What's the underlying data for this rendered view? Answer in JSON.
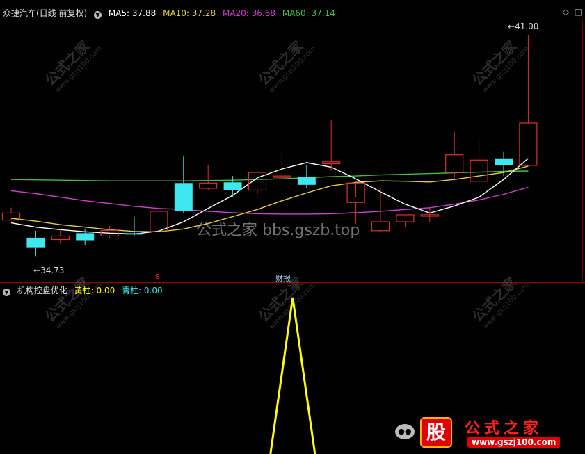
{
  "main_legend": {
    "title": "众捷汽车(日线 前复权)",
    "ma5": "MA5: 37.88",
    "ma10": "MA10: 37.28",
    "ma20": "MA20: 36.68",
    "ma60": "MA60: 37.14",
    "colors": {
      "ma5": "#ffffff",
      "ma10": "#e6d040",
      "ma20": "#d040d0",
      "ma60": "#40c040"
    }
  },
  "sub_legend": {
    "title": "机构控盘优化",
    "yellow": "黄柱: 0.00",
    "cyan": "青柱: 0.00",
    "colors": {
      "yellow": "#ffff00",
      "cyan": "#40e0e0"
    }
  },
  "annotations": {
    "high_label": "41.00",
    "low_label": "34.73",
    "event_label": "财报",
    "s_marker": "S"
  },
  "watermark_center": "公式之家 bbs.gszb.top",
  "watermark_tile": {
    "name": "公式之家",
    "url": "www.gszj100.com"
  },
  "brand": {
    "gu": "股",
    "name": "公式之家",
    "url": "www.gszj100.com"
  },
  "candles": [
    {
      "o": 35.95,
      "h": 36.1,
      "l": 35.8,
      "c": 35.75,
      "up": false
    },
    {
      "o": 35.25,
      "h": 35.45,
      "l": 34.73,
      "c": 34.98,
      "up": true
    },
    {
      "o": 35.2,
      "h": 35.48,
      "l": 35.08,
      "c": 35.3,
      "up": false
    },
    {
      "o": 35.18,
      "h": 35.5,
      "l": 35.05,
      "c": 35.38,
      "up": true
    },
    {
      "o": 35.46,
      "h": 35.58,
      "l": 35.25,
      "c": 35.3,
      "up": false
    },
    {
      "o": 35.38,
      "h": 35.85,
      "l": 35.3,
      "c": 35.35,
      "up": true
    },
    {
      "o": 35.42,
      "h": 36.0,
      "l": 35.36,
      "c": 36.0,
      "up": false
    },
    {
      "o": 36.0,
      "h": 37.55,
      "l": 35.95,
      "c": 36.8,
      "up": true
    },
    {
      "o": 36.8,
      "h": 37.3,
      "l": 36.6,
      "c": 36.65,
      "up": false
    },
    {
      "o": 36.82,
      "h": 37.0,
      "l": 36.4,
      "c": 36.6,
      "up": true
    },
    {
      "o": 36.6,
      "h": 37.1,
      "l": 36.5,
      "c": 37.1,
      "up": false
    },
    {
      "o": 37.0,
      "h": 37.7,
      "l": 36.8,
      "c": 37.0,
      "up": false
    },
    {
      "o": 36.75,
      "h": 37.3,
      "l": 36.65,
      "c": 36.98,
      "up": true
    },
    {
      "o": 37.35,
      "h": 38.6,
      "l": 37.15,
      "c": 37.4,
      "up": false
    },
    {
      "o": 36.8,
      "h": 36.4,
      "l": 35.65,
      "c": 36.25,
      "up": false
    },
    {
      "o": 35.45,
      "h": 36.65,
      "l": 35.4,
      "c": 35.7,
      "up": false
    },
    {
      "o": 35.7,
      "h": 35.9,
      "l": 35.55,
      "c": 35.9,
      "up": false
    },
    {
      "o": 35.9,
      "h": 36.1,
      "l": 35.7,
      "c": 35.9,
      "up": false
    },
    {
      "o": 37.1,
      "h": 38.25,
      "l": 36.85,
      "c": 37.6,
      "up": false
    },
    {
      "o": 36.85,
      "h": 38.05,
      "l": 36.8,
      "c": 37.45,
      "up": false
    },
    {
      "o": 37.3,
      "h": 37.7,
      "l": 37.0,
      "c": 37.5,
      "up": true
    },
    {
      "o": 37.3,
      "h": 41.0,
      "l": 37.3,
      "c": 38.5,
      "up": false
    }
  ],
  "ma_lines": {
    "ma5": [
      35.67,
      35.55,
      35.48,
      35.42,
      35.38,
      35.36,
      35.44,
      35.7,
      36.08,
      36.45,
      36.95,
      37.2,
      37.38,
      37.25,
      36.92,
      36.55,
      36.2,
      35.95,
      36.15,
      36.4,
      36.9,
      37.5
    ],
    "ma10": [
      35.8,
      35.72,
      35.62,
      35.55,
      35.48,
      35.43,
      35.42,
      35.5,
      35.65,
      35.85,
      36.05,
      36.3,
      36.52,
      36.72,
      36.82,
      36.86,
      36.85,
      36.83,
      36.9,
      37.0,
      37.1,
      37.28
    ],
    "ma20": [
      36.58,
      36.5,
      36.4,
      36.3,
      36.22,
      36.14,
      36.08,
      36.05,
      36.0,
      35.96,
      35.93,
      35.92,
      35.92,
      35.93,
      35.96,
      36.0,
      36.05,
      36.1,
      36.2,
      36.32,
      36.48,
      36.68
    ],
    "ma60": [
      36.9,
      36.89,
      36.88,
      36.87,
      36.86,
      36.86,
      36.86,
      36.86,
      36.87,
      36.88,
      36.9,
      36.92,
      36.95,
      36.98,
      37.0,
      37.03,
      37.05,
      37.07,
      37.09,
      37.11,
      37.13,
      37.14
    ]
  },
  "sub_signal": {
    "peak_index": 12,
    "peak_value": 1.0
  }
}
